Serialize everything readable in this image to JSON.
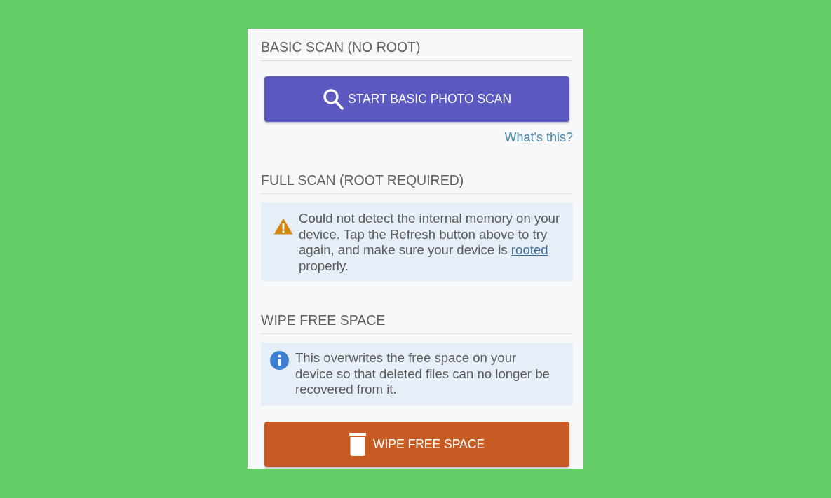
{
  "sections": [
    {
      "heading": "BASIC SCAN (NO ROOT)",
      "items": [
        {
          "kind": "scan-button",
          "label": "START BASIC PHOTO SCAN"
        },
        {
          "kind": "link",
          "label": "What's this?"
        }
      ]
    },
    {
      "heading": "FULL SCAN (ROOT REQUIRED)",
      "items": [
        {
          "kind": "warning-notice",
          "text": "Could not detect the internal memory on your device. Tap the Refresh button above to try again, and make sure your device is",
          "link": "rooted",
          "text_after": "properly."
        }
      ]
    },
    {
      "heading": "WIPE FREE SPACE",
      "items": [
        {
          "kind": "info-notice",
          "text": "This overwrites the free space on your device so that deleted files can no longer be recovered from it."
        },
        {
          "kind": "wipe-button",
          "label": "WIPE FREE SPACE"
        }
      ]
    }
  ]
}
